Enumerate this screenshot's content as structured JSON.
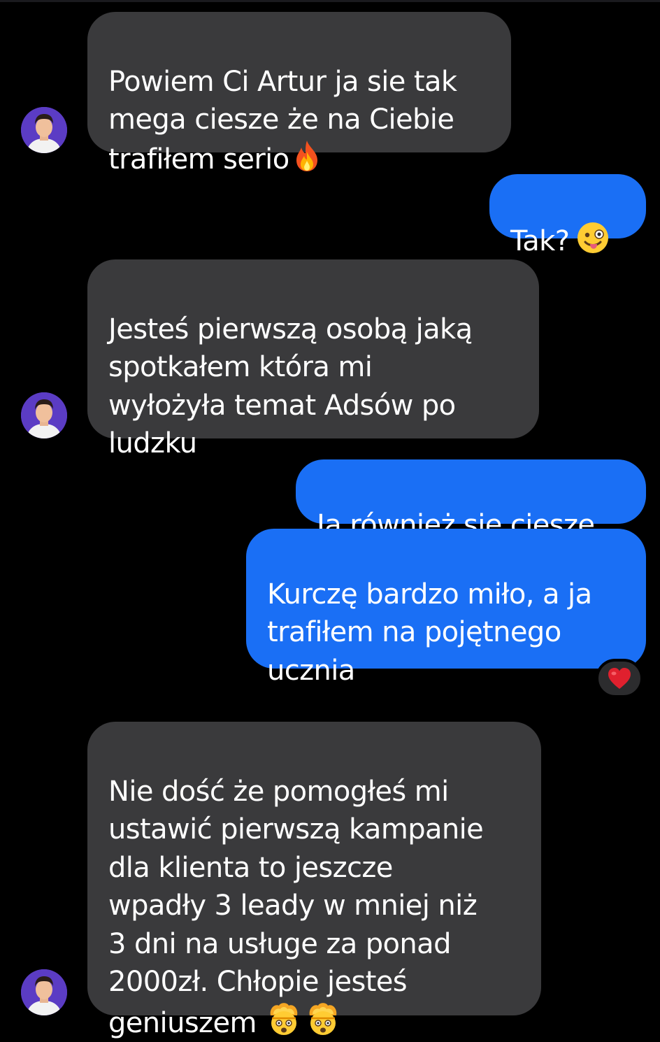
{
  "conversation": {
    "messages": [
      {
        "direction": "incoming",
        "text": "Powiem Ci Artur ja sie tak\nmega ciesze że na Ciebie\ntrafiłem serio",
        "emoji": [
          "fire-icon"
        ]
      },
      {
        "direction": "outgoing",
        "text": "Tak?",
        "emoji": [
          "winking-face-with-tongue-icon"
        ]
      },
      {
        "direction": "incoming",
        "text": "Jesteś pierwszą osobą jaką\nspotkałem która mi\nwyłożyła temat Adsów po\nludzku",
        "emoji": []
      },
      {
        "direction": "outgoing",
        "text": "Ja również się cieszę",
        "emoji": []
      },
      {
        "direction": "outgoing",
        "text": "Kurczę bardzo miło, a ja\ntrafiłem na pojętnego\nucznia",
        "emoji": [],
        "reaction": "red-heart-icon"
      },
      {
        "direction": "incoming",
        "text": "Nie dość że pomogłeś mi\nustawić pierwszą kampanie\ndla klienta to jeszcze\nwpadły 3 leady w mniej niż\n3 dni na usługe za ponad\n2000zł. Chłopie jesteś\ngeniuszem",
        "emoji": [
          "exploding-head-icon",
          "exploding-head-icon"
        ]
      }
    ]
  },
  "colors": {
    "background": "#000000",
    "incoming_bubble": "#3a3a3c",
    "outgoing_bubble": "#1a6ff5",
    "text": "#ffffff",
    "avatar_background": "#5b3cc4",
    "reaction_pill": "#2c2c2e",
    "heart": "#e0202e"
  }
}
